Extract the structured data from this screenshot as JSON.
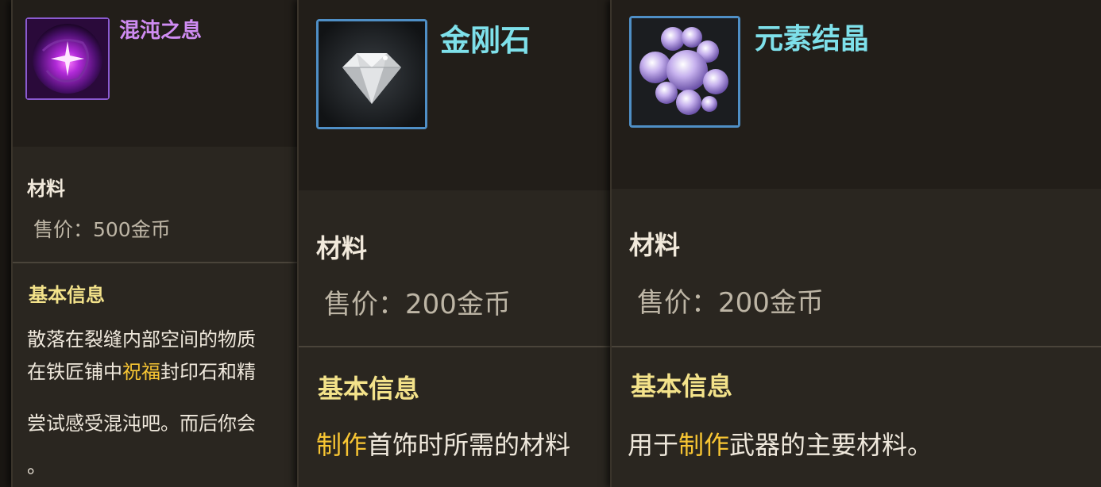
{
  "tooltips": [
    {
      "name": "混沌之息",
      "type": "材料",
      "price": "售价：500金币",
      "section_title": "基本信息",
      "desc_line1": "散落在裂缝内部空间的物质",
      "desc_line2_pre": "在铁匠铺中",
      "desc_line2_hl": "祝福",
      "desc_line2_post": "封印石和精",
      "desc_line3": "尝试感受混沌吧。而后你会",
      "desc_line4": "。",
      "icon": "chaos-orb-icon"
    },
    {
      "name": "金刚石",
      "type": "材料",
      "price": "售价：200金币",
      "section_title": "基本信息",
      "desc_hl": "制作",
      "desc_post": "首饰时所需的材料",
      "icon": "diamond-icon"
    },
    {
      "name": "元素结晶",
      "type": "材料",
      "price": "售价：200金币",
      "section_title": "基本信息",
      "desc_pre": "用于",
      "desc_hl": "制作",
      "desc_post": "武器的主要材料。",
      "icon": "element-crystal-icon"
    }
  ],
  "colors": {
    "name_purple": "#cf8cf2",
    "name_cyan": "#7ee0ea",
    "section_yellow": "#f3e28a",
    "highlight": "#f7c533"
  }
}
